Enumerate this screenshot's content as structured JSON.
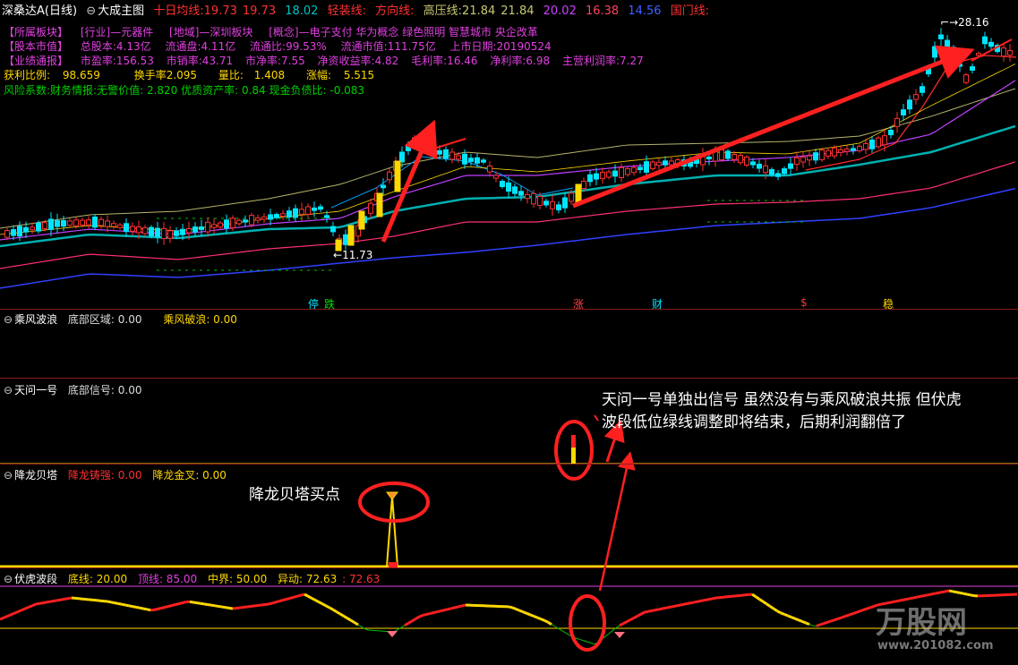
{
  "header": {
    "stock": "深桑达A",
    "period": "(日线)",
    "chart": "大成主图",
    "ma10_label": "十日均线:",
    "ma10_a": "19.73",
    "ma10_b": "19.73",
    "v1": "18.02",
    "light_label": "轻装线:",
    "dir_label": "方向线:",
    "high_label": "高压线:",
    "high_a": "21.84",
    "high_b": "21.84",
    "v2": "20.02",
    "v3": "16.38",
    "v4": "14.56",
    "gate_label": "国门线:"
  },
  "info": {
    "row1": [
      "【所属板块】",
      "[行业]—元器件",
      "[地域]—深圳板块",
      "[概念]—电子支付 华为概念 绿色照明 智慧城市 央企改革"
    ],
    "row2": [
      "【股本市值】",
      "总股本:4.13亿",
      "流通盘:4.11亿",
      "流通比:99.53%",
      "流通市值:111.75亿",
      "上市日期:20190524"
    ],
    "row3": [
      "【业绩通报】",
      "市盈率:156.53",
      "市销率:43.71",
      "市净率:7.55",
      "净资收益率:4.82",
      "毛利率:16.46",
      "净利率:6.98",
      "主营利润率:7.27"
    ],
    "row4": [
      "获利比例:",
      "98.659",
      "换手率2.095",
      "量比:",
      "1.408",
      "涨幅:",
      "5.515"
    ],
    "row5": "风险系数:财务情报:无警价值: 2.820 优质资产率: 0.84 现金负债比: -0.083"
  },
  "price_labels": {
    "high": "28.16",
    "low": "11.73"
  },
  "markers": {
    "ting": "停",
    "die": "跌",
    "zhang": "涨",
    "cai": "财",
    "s": "$",
    "wen": "稳"
  },
  "panel1": {
    "name": "乘风波浪",
    "field1": "底部区域: 0.00",
    "field2": "乘风破浪: 0.00"
  },
  "panel2": {
    "name": "天问一号",
    "field1": "底部信号: 0.00"
  },
  "panel3": {
    "name": "降龙贝塔",
    "field1": "降龙铸强: 0.00",
    "field2": "降龙金叉: 0.00"
  },
  "panel4": {
    "name": "伏虎波段",
    "f1": "底线: 20.00",
    "f2": "顶线: 85.00",
    "f3": "中界: 50.00",
    "f4": "异动: 72.63",
    "f5": ": 72.63"
  },
  "annotations": {
    "tianwen_line1": "天问一号单独出信号 虽然没有与乘风破浪共振 但伏虎",
    "tianwen_line2": "波段低位绿线调整即将结束，后期利润翻倍了",
    "xianglong": "降龙贝塔买点"
  },
  "watermark": {
    "brand": "万股网",
    "url": "www.201082.com"
  },
  "colors": {
    "up": "#ff3030",
    "down": "#00e5ff",
    "yellow": "#ffd800",
    "magenta": "#e000e0",
    "green": "#00d000"
  }
}
